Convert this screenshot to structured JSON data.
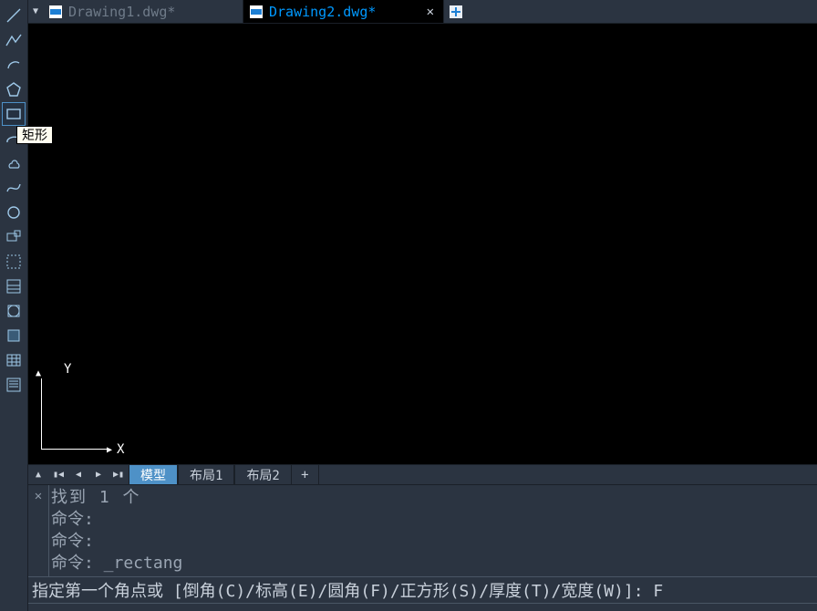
{
  "tooltip": "矩形",
  "file_tabs": {
    "items": [
      {
        "label": "Drawing1.dwg*"
      },
      {
        "label": "Drawing2.dwg*"
      }
    ]
  },
  "ucs": {
    "x": "X",
    "y": "Y"
  },
  "layout_tabs": {
    "items": [
      {
        "label": "模型"
      },
      {
        "label": "布局1"
      },
      {
        "label": "布局2"
      }
    ],
    "add": "+"
  },
  "cmd_log": {
    "lines": [
      "找到 1 个",
      "命令:",
      "命令:",
      "命令: _rectang"
    ]
  },
  "cmd_input": "指定第一个角点或 [倒角(C)/标高(E)/圆角(F)/正方形(S)/厚度(T)/宽度(W)]: F",
  "tools": [
    "line",
    "polyline",
    "arc",
    "polygon",
    "rectangle",
    "ellipse-arc",
    "revcloud",
    "spline",
    "circle",
    "insert",
    "attach",
    "hatch",
    "boundary",
    "region",
    "table",
    "point"
  ]
}
